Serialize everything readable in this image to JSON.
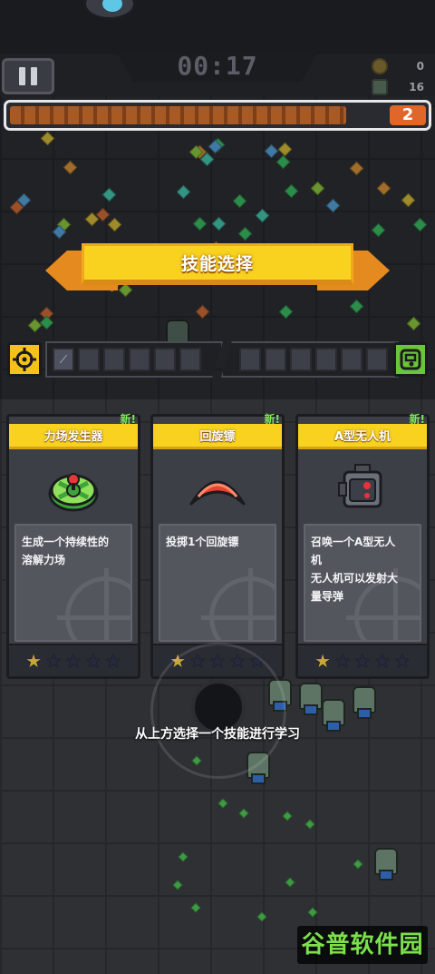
{
  "hud": {
    "timer": "00:17",
    "coins": "0",
    "kills": "16",
    "level": "2",
    "xp_progress": 0.9
  },
  "banner": {
    "title": "技能选择"
  },
  "equipped": {
    "active_slots": 6,
    "passive_slots": 6,
    "active_filled": [
      "kunai-icon"
    ]
  },
  "cards": [
    {
      "new_label": "新!",
      "name": "力场发生器",
      "icon": "force-field-generator-icon",
      "description": "生成一个持续性的\n溶解力场",
      "stars_filled": 1,
      "stars_total": 5
    },
    {
      "new_label": "新!",
      "name": "回旋镖",
      "icon": "boomerang-icon",
      "description": "投掷1个回旋镖",
      "stars_filled": 1,
      "stars_total": 5
    },
    {
      "new_label": "新!",
      "name": "A型无人机",
      "icon": "drone-icon",
      "description": "召唤一个A型无人\n机\n无人机可以发射大\n量导弹",
      "stars_filled": 1,
      "stars_total": 5
    }
  ],
  "hint": "从上方选择一个技能进行学习",
  "watermark": "谷普软件园",
  "colors": {
    "accent_yellow": "#f8d21e",
    "banner_orange": "#e58a1f",
    "new_green": "#7ee85e",
    "xp_orange": "#e0662a"
  }
}
